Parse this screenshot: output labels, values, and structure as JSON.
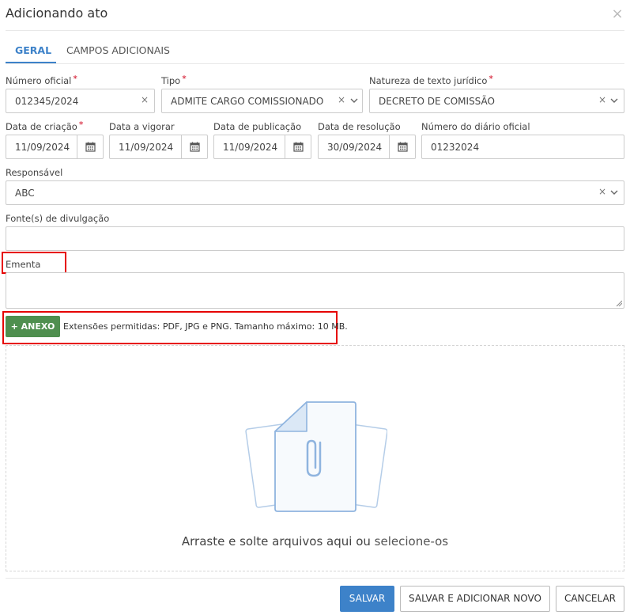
{
  "dialog": {
    "title": "Adicionando ato"
  },
  "tabs": [
    {
      "label": "GERAL",
      "active": true
    },
    {
      "label": "CAMPOS ADICIONAIS",
      "active": false
    }
  ],
  "fields": {
    "numero_oficial": {
      "label": "Número oficial",
      "required": "*",
      "value": "012345/2024",
      "clear": "×"
    },
    "tipo": {
      "label": "Tipo",
      "required": "*",
      "value": "ADMITE CARGO COMISSIONADO",
      "clear": "×"
    },
    "natureza": {
      "label": "Natureza de texto jurídico",
      "required": "*",
      "value": "DECRETO DE COMISSÃO",
      "clear": "×"
    },
    "data_criacao": {
      "label": "Data de criação",
      "required": "*",
      "value": "11/09/2024"
    },
    "data_vigorar": {
      "label": "Data a vigorar",
      "value": "11/09/2024"
    },
    "data_publicacao": {
      "label": "Data de publicação",
      "value": "11/09/2024"
    },
    "data_resolucao": {
      "label": "Data de resolução",
      "value": "30/09/2024"
    },
    "numero_diario": {
      "label": "Número do diário oficial",
      "value": "01232024"
    },
    "responsavel": {
      "label": "Responsável",
      "value": "ABC",
      "clear": "×"
    },
    "fontes": {
      "label": "Fonte(s) de divulgação",
      "value": ""
    },
    "ementa": {
      "label": "Ementa",
      "value": ""
    }
  },
  "attachments": {
    "button_label": "+ ANEXO",
    "hint": "Extensões permitidas: PDF, JPG e PNG. Tamanho máximo: 10 MB.",
    "drop_text": "Arraste e solte arquivos aqui ou ",
    "select_link": "selecione-os",
    "illustration": "paperclip-files-icon"
  },
  "footer": {
    "save": "SALVAR",
    "save_and_new": "SALVAR E ADICIONAR NOVO",
    "cancel": "CANCELAR"
  },
  "colors": {
    "accent": "#3d82c9",
    "success": "#4f8f4f",
    "required": "#d0021b",
    "highlight": "#e60000"
  }
}
